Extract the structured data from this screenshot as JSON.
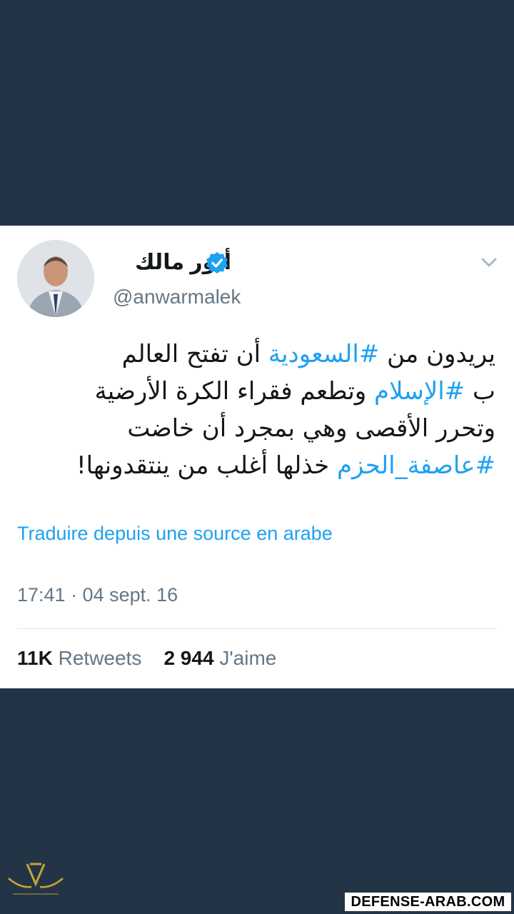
{
  "tweet": {
    "display_name": "أنور مالك",
    "handle": "@anwarmalek",
    "verified": true,
    "text_lines": [
      [
        {
          "t": "يريدون من "
        },
        {
          "t": "#السعودية",
          "tag": true
        },
        {
          "t": " أن تفتح العالم"
        }
      ],
      [
        {
          "t": "ب "
        },
        {
          "t": "#الإسلام",
          "tag": true
        },
        {
          "t": " وتطعم فقراء الكرة الأرضية"
        }
      ],
      [
        {
          "t": "وتحرر الأقصى وهي بمجرد أن خاضت"
        }
      ],
      [
        {
          "t": "#عاصفة_الحزم",
          "tag": true
        },
        {
          "t": " خذلها أغلب من ينتقدونها!"
        }
      ]
    ],
    "translate_label": "Traduire depuis une source en arabe",
    "timestamp": "17:41 · 04 sept. 16",
    "retweets_count": "11K",
    "retweets_label": "Retweets",
    "likes_count": "2 944",
    "likes_label": "J'aime"
  },
  "icons": {
    "avatar": "user-avatar-photo",
    "verified": "verified-badge-icon",
    "menu": "chevron-down-icon"
  },
  "colors": {
    "background": "#243447",
    "card": "#ffffff",
    "accent": "#1da1f2",
    "text": "#14171a",
    "muted": "#657786"
  },
  "watermark": {
    "site": "DEFENSE-ARAB.COM"
  }
}
